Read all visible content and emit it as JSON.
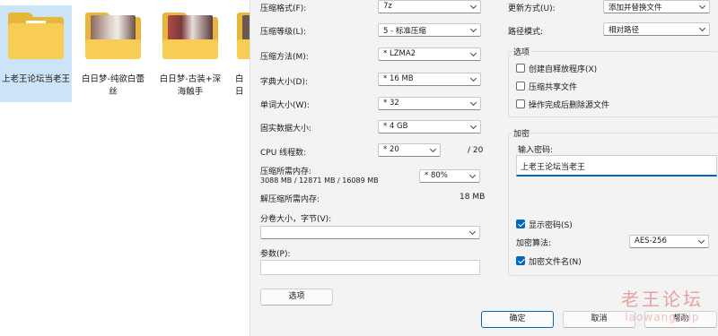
{
  "explorer": {
    "folders": [
      {
        "name": "上老王论坛当老王"
      },
      {
        "name": "白日梦-纯欲白蕾丝"
      },
      {
        "name": "白日梦-古装+深海触手"
      },
      {
        "name": "白日"
      }
    ]
  },
  "dialog": {
    "archive_format": {
      "label": "压缩格式(F):",
      "value": "7z"
    },
    "compression_level": {
      "label": "压缩等级(L):",
      "value": "5 - 标准压缩"
    },
    "compression_method": {
      "label": "压缩方法(M):",
      "value": "* LZMA2"
    },
    "dictionary_size": {
      "label": "字典大小(D):",
      "value": "* 16 MB"
    },
    "word_size": {
      "label": "单词大小(W):",
      "value": "* 32"
    },
    "solid_block": {
      "label": "固实数据大小:",
      "value": "* 4 GB"
    },
    "cpu_threads": {
      "label": "CPU 线程数:",
      "value": "* 20",
      "max": "/ 20"
    },
    "memory_compress": {
      "label": "压缩所需内存:",
      "detail": "3088 MB / 12871 MB / 16089 MB",
      "value": "* 80%"
    },
    "memory_decompress": {
      "label": "解压缩所需内存:",
      "value": "18 MB"
    },
    "split_volumes": {
      "label": "分卷大小，字节(V):",
      "value": ""
    },
    "parameters": {
      "label": "参数(P):",
      "value": ""
    },
    "options_button": "选项",
    "update_mode": {
      "label": "更新方式(U):",
      "value": "添加并替换文件"
    },
    "path_mode": {
      "label": "路径模式:",
      "value": "相对路径"
    },
    "options_group": {
      "title": "选项",
      "items": [
        {
          "label": "创建自释放程序(X)",
          "checked": false
        },
        {
          "label": "压缩共享文件",
          "checked": false
        },
        {
          "label": "操作完成后删除源文件",
          "checked": false
        }
      ]
    },
    "encryption": {
      "title": "加密",
      "password_label": "输入密码:",
      "password_value": "上老王论坛当老王",
      "show_password": {
        "label": "显示密码(S)",
        "checked": true
      },
      "method_label": "加密算法:",
      "method_value": "AES-256",
      "encrypt_names": {
        "label": "加密文件名(N)",
        "checked": true
      }
    },
    "buttons": {
      "ok": "确定",
      "cancel": "取消",
      "help": "帮助"
    }
  },
  "watermark": {
    "line1": "老王论坛",
    "line2": "laowang.vip"
  },
  "colors": {
    "accent": "#0067c0",
    "folder": "#f7cd55",
    "selection": "#cce4f7"
  }
}
